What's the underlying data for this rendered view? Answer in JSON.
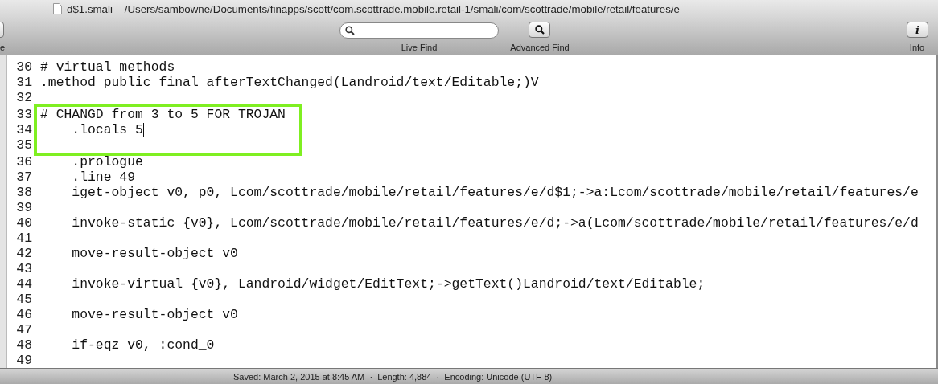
{
  "window": {
    "title": "d$1.smali – /Users/sambowne/Documents/finapps/scott/com.scottrade.mobile.retail-1/smali/com/scottrade/mobile/retail/features/e"
  },
  "toolbar": {
    "cut_label": "e",
    "live_find": {
      "label": "Live Find"
    },
    "advanced_find": {
      "label": "Advanced Find"
    },
    "info": {
      "label": "Info",
      "glyph": "i"
    }
  },
  "lines": [
    {
      "number": "30",
      "text": "# virtual methods",
      "boxed": false,
      "cursor": false
    },
    {
      "number": "31",
      "text": ".method public final afterTextChanged(Landroid/text/Editable;)V",
      "boxed": false,
      "cursor": false
    },
    {
      "number": "32",
      "boxed": false,
      "cursor": false
    },
    {
      "number": "33",
      "text": "# CHANGD from 3 to 5 FOR TROJAN",
      "boxed": true,
      "cursor": false
    },
    {
      "number": "34",
      "text": "    .locals 5",
      "boxed": true,
      "cursor": true
    },
    {
      "number": "35",
      "boxed": true,
      "cursor": false
    },
    {
      "number": "36",
      "text": "    .prologue",
      "boxed": false,
      "cursor": false
    },
    {
      "number": "37",
      "text": "    .line 49",
      "boxed": false,
      "cursor": false
    },
    {
      "number": "38",
      "text": "    iget-object v0, p0, Lcom/scottrade/mobile/retail/features/e/d$1;->a:Lcom/scottrade/mobile/retail/features/e",
      "boxed": false,
      "cursor": false
    },
    {
      "number": "39",
      "boxed": false,
      "cursor": false
    },
    {
      "number": "40",
      "text": "    invoke-static {v0}, Lcom/scottrade/mobile/retail/features/e/d;->a(Lcom/scottrade/mobile/retail/features/e/d",
      "boxed": false,
      "cursor": false
    },
    {
      "number": "41",
      "boxed": false,
      "cursor": false
    },
    {
      "number": "42",
      "text": "    move-result-object v0",
      "boxed": false,
      "cursor": false
    },
    {
      "number": "43",
      "boxed": false,
      "cursor": false
    },
    {
      "number": "44",
      "text": "    invoke-virtual {v0}, Landroid/widget/EditText;->getText()Landroid/text/Editable;",
      "boxed": false,
      "cursor": false
    },
    {
      "number": "45",
      "boxed": false,
      "cursor": false
    },
    {
      "number": "46",
      "text": "    move-result-object v0",
      "boxed": false,
      "cursor": false
    },
    {
      "number": "47",
      "boxed": false,
      "cursor": false
    },
    {
      "number": "48",
      "text": "    if-eqz v0, :cond_0",
      "boxed": false,
      "cursor": false
    },
    {
      "number": "49",
      "boxed": false,
      "cursor": false
    }
  ],
  "status_bar": {
    "text": "Saved: March 2, 2015 at 8:45 AM  ·  Length: 4,884  ·  Encoding: Unicode (UTF-8)"
  }
}
